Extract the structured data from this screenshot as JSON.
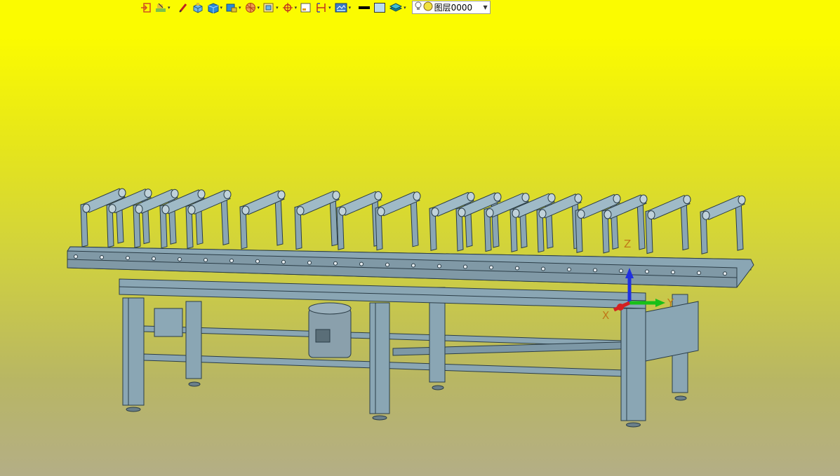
{
  "toolbar": {
    "buttons": [
      {
        "name": "exit-sketch-icon"
      },
      {
        "name": "sketch-tools-icon",
        "dropdown": true
      },
      {
        "name": "brush-icon"
      },
      {
        "name": "extrude-icon"
      },
      {
        "name": "solid-box-icon",
        "dropdown": true
      },
      {
        "name": "surface-icon",
        "dropdown": true
      },
      {
        "name": "sphere-icon",
        "dropdown": true
      },
      {
        "name": "frame-icon",
        "dropdown": true
      },
      {
        "name": "point-icon",
        "dropdown": true
      },
      {
        "name": "datum-plane-icon"
      },
      {
        "name": "dimension-icon",
        "dropdown": true
      },
      {
        "name": "render-mode-icon",
        "dropdown": true
      },
      {
        "name": "line-color-icon"
      },
      {
        "name": "fill-color-icon"
      },
      {
        "name": "layer-stack-icon",
        "dropdown": true
      }
    ],
    "layer": {
      "value": "图层0000",
      "icons": [
        "lightbulb-icon",
        "layer-color-icon"
      ]
    }
  },
  "viewport": {
    "triad_labels": {
      "x": "X",
      "y": "Y",
      "z": "Z"
    },
    "colors": {
      "model": "#8aa6b4",
      "model_edge": "#2b3d47",
      "axis_x": "#d42020",
      "axis_y": "#18c018",
      "axis_z": "#2030e0",
      "triad_label": "#c07818"
    }
  }
}
